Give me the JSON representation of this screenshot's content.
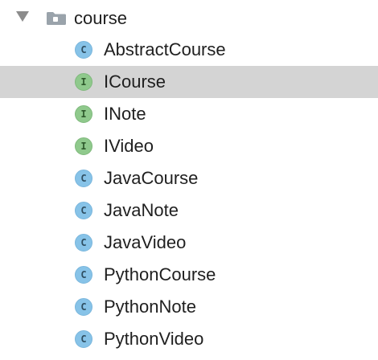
{
  "tree": {
    "folder": {
      "label": "course",
      "expanded": true,
      "icon": "folder-icon",
      "chevron": "chevron-down-icon"
    },
    "items": [
      {
        "label": "AbstractCourse",
        "kind": "class",
        "letter": "C",
        "selected": false
      },
      {
        "label": "ICourse",
        "kind": "interface",
        "letter": "I",
        "selected": true
      },
      {
        "label": "INote",
        "kind": "interface",
        "letter": "I",
        "selected": false
      },
      {
        "label": "IVideo",
        "kind": "interface",
        "letter": "I",
        "selected": false
      },
      {
        "label": "JavaCourse",
        "kind": "class",
        "letter": "C",
        "selected": false
      },
      {
        "label": "JavaNote",
        "kind": "class",
        "letter": "C",
        "selected": false
      },
      {
        "label": "JavaVideo",
        "kind": "class",
        "letter": "C",
        "selected": false
      },
      {
        "label": "PythonCourse",
        "kind": "class",
        "letter": "C",
        "selected": false
      },
      {
        "label": "PythonNote",
        "kind": "class",
        "letter": "C",
        "selected": false
      },
      {
        "label": "PythonVideo",
        "kind": "class",
        "letter": "C",
        "selected": false
      }
    ]
  },
  "colors": {
    "selection": "#d4d4d4",
    "class_icon": "#87c3e8",
    "interface_icon": "#8fc98c",
    "text": "#1f1f1f",
    "chevron": "#8c8c8c",
    "folder": "#9aa3ab"
  }
}
